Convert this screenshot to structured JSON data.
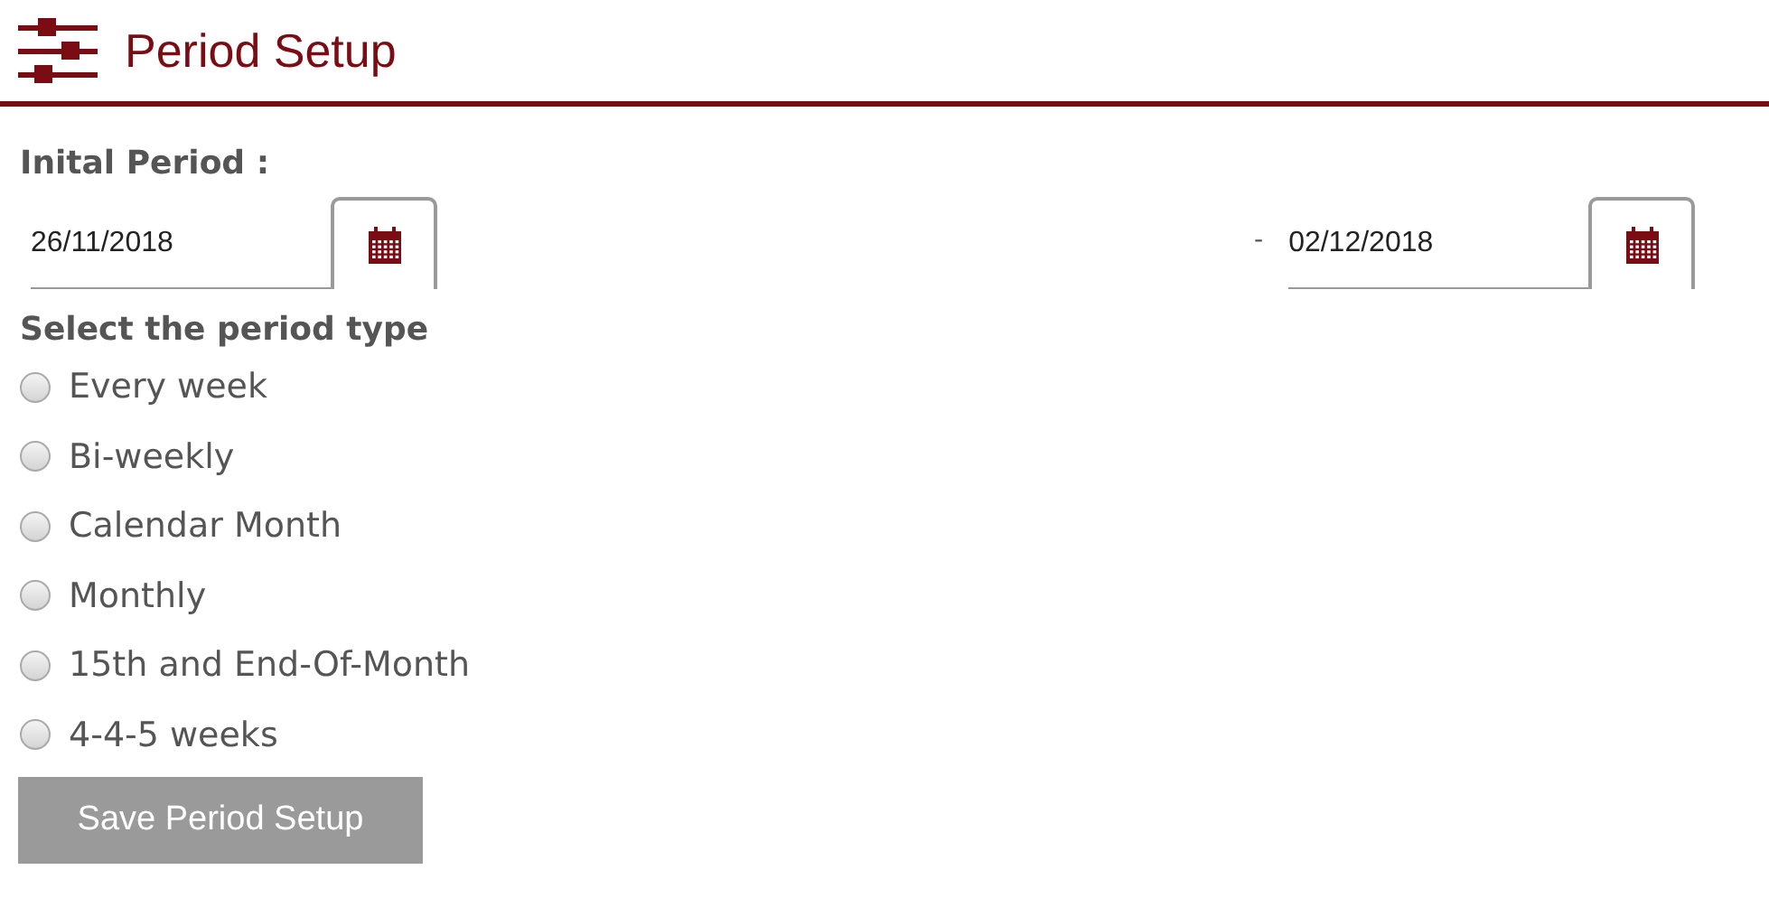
{
  "header": {
    "title": "Period Setup"
  },
  "initial_period": {
    "label": "Inital Period :",
    "start": {
      "value": "26/11/2018"
    },
    "separator": "-",
    "end": {
      "value": "02/12/2018"
    }
  },
  "period_type": {
    "label": "Select the period type",
    "options": [
      {
        "label": "Every week",
        "selected": false
      },
      {
        "label": "Bi-weekly",
        "selected": false
      },
      {
        "label": "Calendar Month",
        "selected": false
      },
      {
        "label": "Monthly",
        "selected": false
      },
      {
        "label": "15th and End-Of-Month",
        "selected": false
      },
      {
        "label": "4-4-5 weeks",
        "selected": false
      }
    ]
  },
  "save_button": "Save Period Setup"
}
